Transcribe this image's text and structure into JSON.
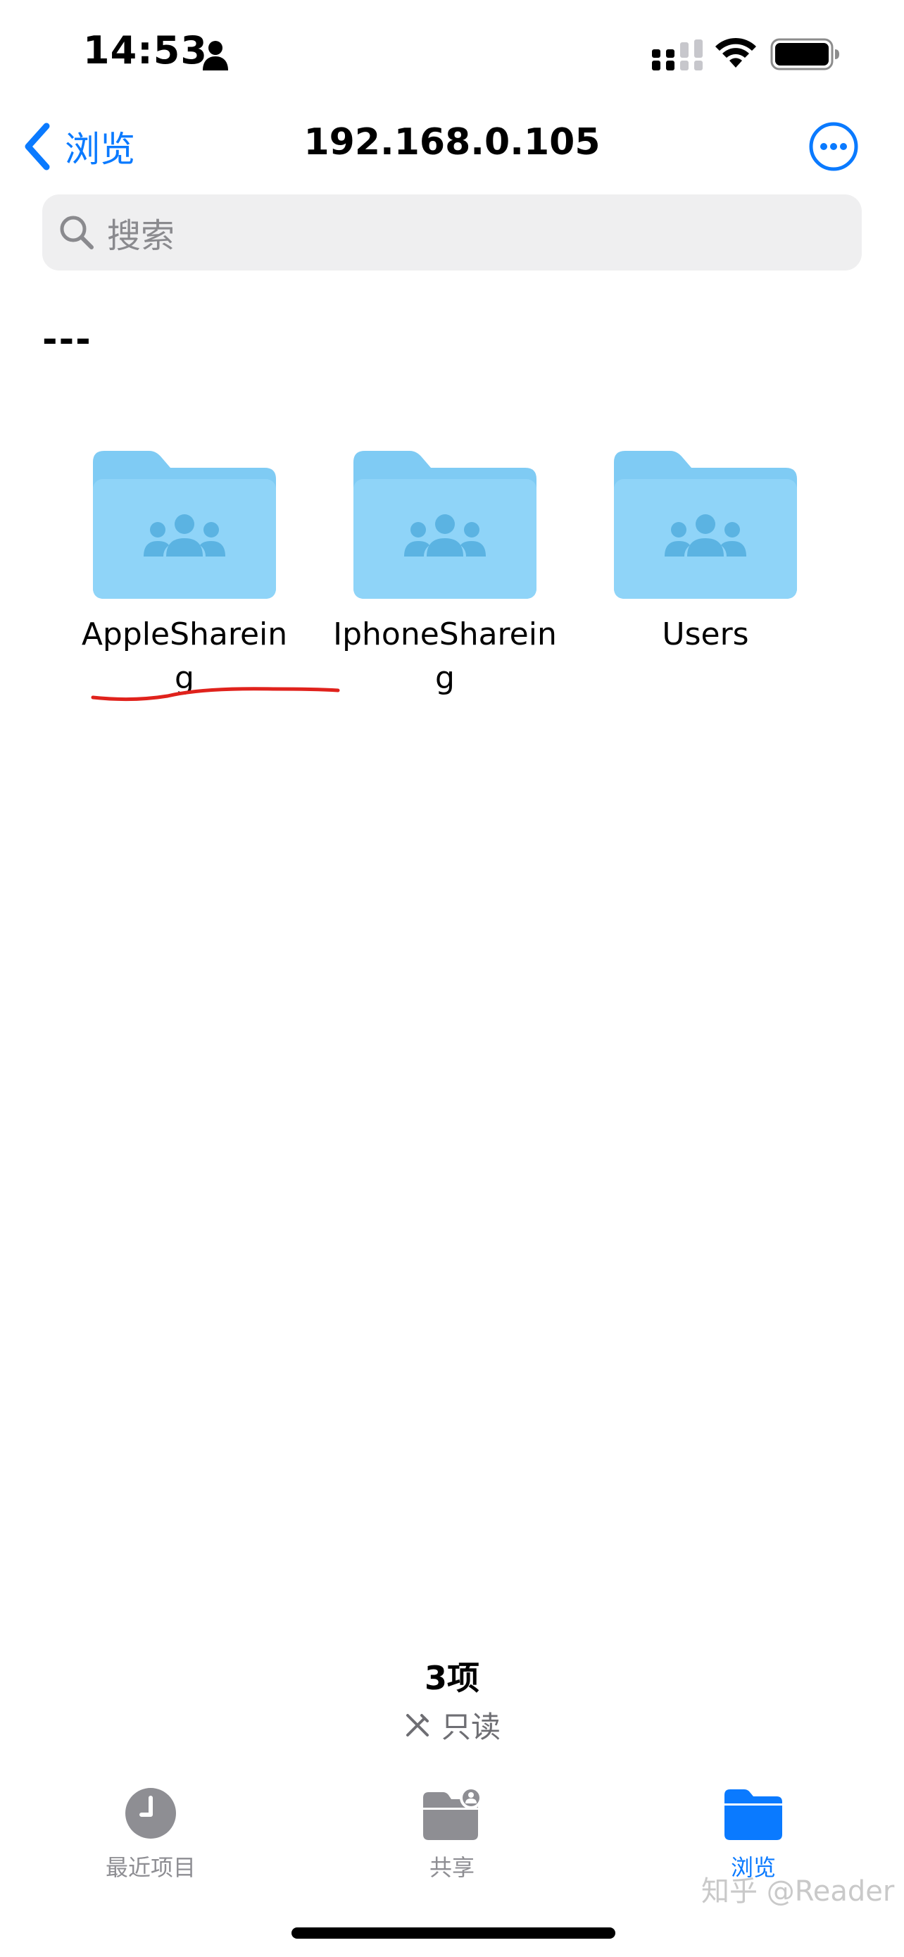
{
  "status_bar": {
    "time": "14:53"
  },
  "nav": {
    "back_label": "浏览",
    "title": "192.168.0.105"
  },
  "search": {
    "placeholder": "搜索"
  },
  "section_label": "---",
  "folders": [
    {
      "label": "AppleShareing"
    },
    {
      "label": "IphoneShareing"
    },
    {
      "label": "Users"
    }
  ],
  "footer": {
    "item_count": "3项",
    "access": "只读"
  },
  "tabs": [
    {
      "label": "最近项目",
      "icon": "clock-icon",
      "active": false
    },
    {
      "label": "共享",
      "icon": "shared-folder-icon",
      "active": false
    },
    {
      "label": "浏览",
      "icon": "folder-icon",
      "active": true
    }
  ],
  "watermark": "知乎 @Reader",
  "colors": {
    "accent": "#0a7aff",
    "folder": "#8fd1f7",
    "annotation": "#e0221c"
  }
}
